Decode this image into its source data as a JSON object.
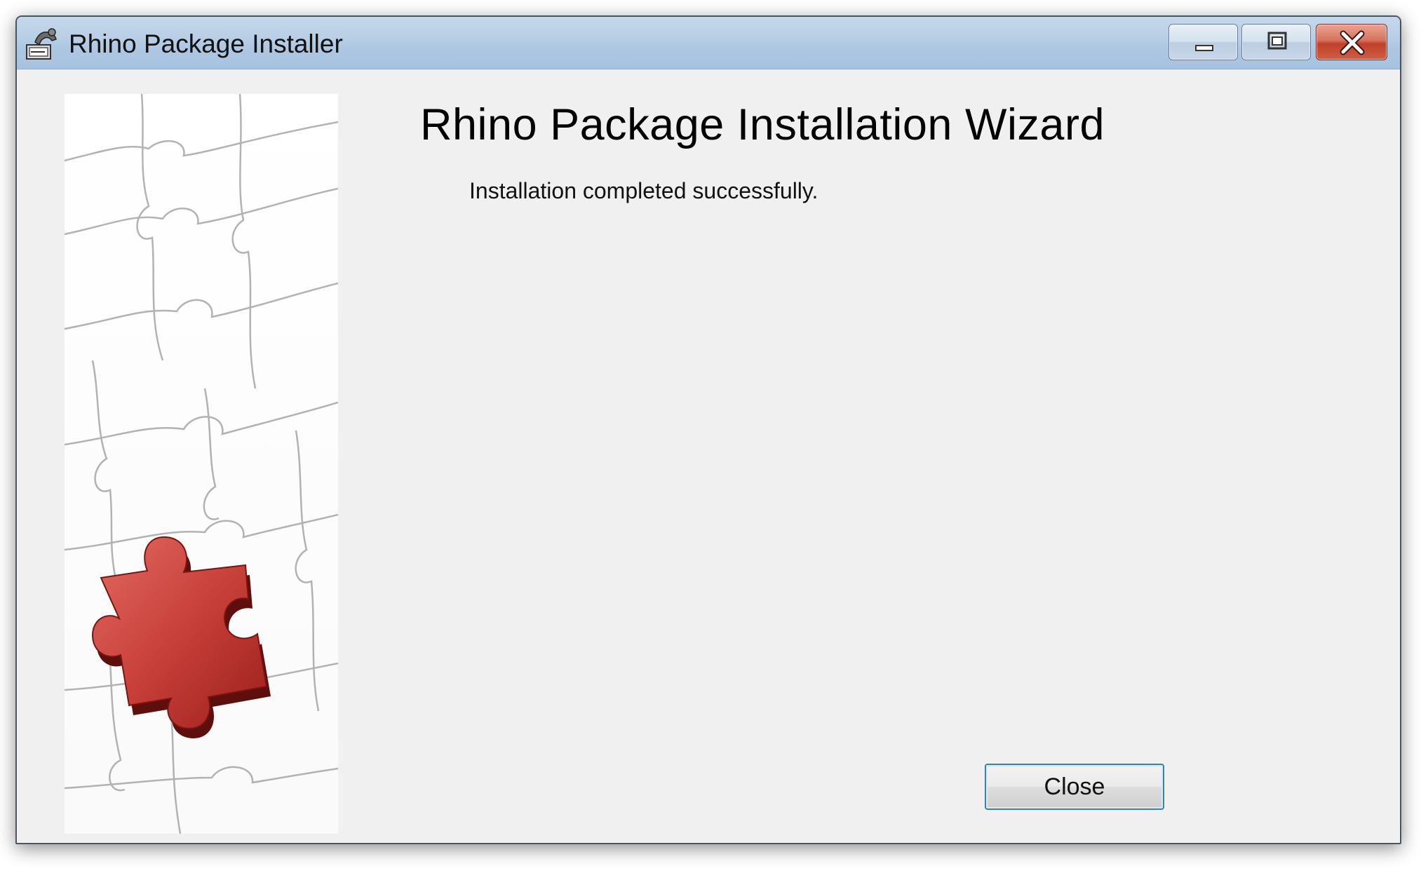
{
  "window": {
    "title": "Rhino Package Installer",
    "app_icon": "rhino-installer-icon",
    "controls": {
      "minimize_icon": "minimize-icon",
      "maximize_icon": "maximize-icon",
      "close_icon": "close-icon"
    }
  },
  "wizard": {
    "heading": "Rhino Package Installation Wizard",
    "status_message": "Installation completed successfully.",
    "side_image": "puzzle-pieces-illustration",
    "close_button_label": "Close"
  },
  "colors": {
    "titlebar": "#b9cfe6",
    "body": "#f0f0f0",
    "puzzle_accent": "#c0302a",
    "close_button_border": "#3c7fb1"
  }
}
